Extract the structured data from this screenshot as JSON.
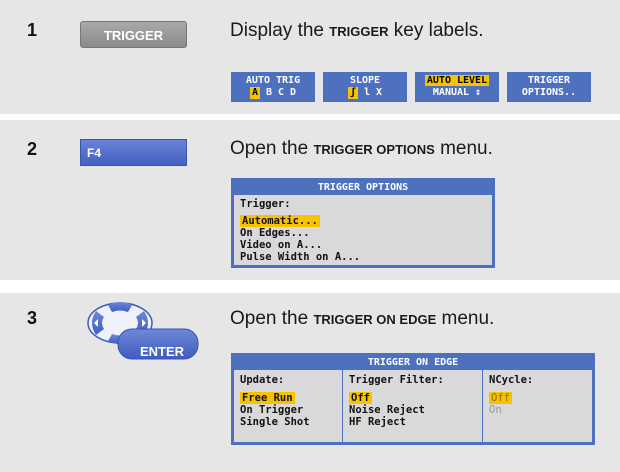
{
  "steps": [
    {
      "number": "1",
      "key_label": "TRIGGER",
      "desc_prefix": "Display the ",
      "desc_bold": "TRIGGER",
      "desc_suffix": " key labels.",
      "softkeys": {
        "f1": {
          "top": "AUTO TRIG",
          "opts": [
            "A",
            "B",
            "C",
            "D"
          ],
          "selected": "A"
        },
        "f2": {
          "top": "SLOPE",
          "opts": [
            "ʃ",
            "l",
            "X"
          ],
          "selected": "ʃ"
        },
        "f3": {
          "top": "AUTO LEVEL",
          "bottom": "MANUAL ↕"
        },
        "f4": {
          "top": "TRIGGER",
          "bottom": "OPTIONS.."
        }
      }
    },
    {
      "number": "2",
      "key_label": "F4",
      "desc_prefix": "Open the ",
      "desc_bold": "TRIGGER OPTIONS",
      "desc_suffix": " menu.",
      "menu": {
        "title": "TRIGGER OPTIONS",
        "heading": "Trigger:",
        "items": [
          "Automatic...",
          "On Edges...",
          "Video on A...",
          "Pulse Width on A..."
        ]
      }
    },
    {
      "number": "3",
      "key_label": "ENTER",
      "desc_prefix": "Open the ",
      "desc_bold": "TRIGGER ON EDGE",
      "desc_suffix": " menu.",
      "menu": {
        "title": "TRIGGER ON EDGE",
        "columns": [
          {
            "heading": "Update:",
            "items": [
              "Free Run",
              "On Trigger",
              "Single Shot"
            ]
          },
          {
            "heading": "Trigger Filter:",
            "items": [
              "Off",
              "Noise Reject",
              "HF Reject"
            ]
          },
          {
            "heading": "NCycle:",
            "items": [
              "Off",
              "On"
            ]
          }
        ]
      }
    }
  ],
  "colors": {
    "menu_blue": "#4d71bf",
    "highlight": "#f7c200",
    "key_blue": "#4361c2",
    "step_bg": "#e6e6e6"
  },
  "icons": {
    "navigation_pad": "arrow-keypad-icon"
  }
}
